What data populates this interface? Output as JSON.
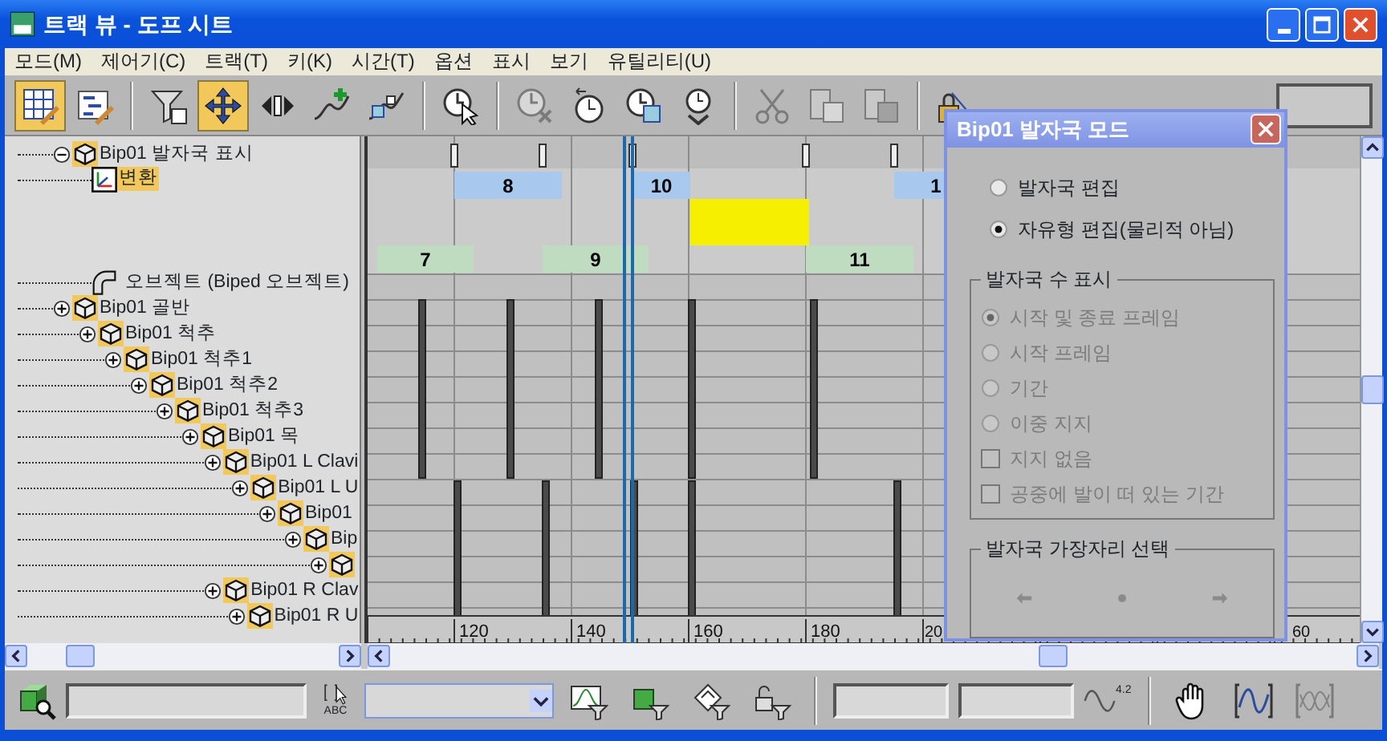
{
  "window": {
    "title": "트랙 뷰 - 도프 시트"
  },
  "menu": [
    "모드(M)",
    "제어기(C)",
    "트랙(T)",
    "키(K)",
    "시간(T)",
    "옵션",
    "표시",
    "보기",
    "유틸리티(U)"
  ],
  "toolbar": [
    {
      "kind": "button",
      "selected": true,
      "disabled": false
    },
    {
      "kind": "button",
      "selected": false,
      "disabled": false
    },
    {
      "kind": "separator"
    },
    {
      "kind": "button",
      "selected": false,
      "disabled": false
    },
    {
      "kind": "button",
      "selected": true,
      "disabled": false
    },
    {
      "kind": "button",
      "selected": false,
      "disabled": false
    },
    {
      "kind": "button",
      "selected": false,
      "disabled": false
    },
    {
      "kind": "button",
      "selected": false,
      "disabled": false
    },
    {
      "kind": "separator"
    },
    {
      "kind": "button",
      "selected": false,
      "disabled": false
    },
    {
      "kind": "separator"
    },
    {
      "kind": "button",
      "selected": false,
      "disabled": true
    },
    {
      "kind": "button",
      "selected": false,
      "disabled": false
    },
    {
      "kind": "button",
      "selected": false,
      "disabled": false
    },
    {
      "kind": "button",
      "selected": false,
      "disabled": false
    },
    {
      "kind": "separator"
    },
    {
      "kind": "button",
      "selected": false,
      "disabled": true
    },
    {
      "kind": "button",
      "selected": false,
      "disabled": true
    },
    {
      "kind": "button",
      "selected": false,
      "disabled": true
    },
    {
      "kind": "separator"
    },
    {
      "kind": "button",
      "selected": false,
      "disabled": false
    }
  ],
  "tree": [
    {
      "kind": "bone",
      "label": "Bip01 발자국 표시",
      "expanded": true,
      "children": [
        {
          "kind": "transform",
          "label": "변환",
          "selected": true
        },
        {
          "kind": "object",
          "label": "오브젝트 (Biped 오브젝트)",
          "selected": false
        }
      ]
    },
    {
      "kind": "bone",
      "label": "Bip01 골반",
      "expanded": false,
      "children": [
        {
          "kind": "bone",
          "label": "Bip01 척추",
          "expanded": false,
          "children": [
            {
              "kind": "bone",
              "label": "Bip01 척추1",
              "expanded": false,
              "children": [
                {
                  "kind": "bone",
                  "label": "Bip01 척추2",
                  "expanded": false,
                  "children": [
                    {
                      "kind": "bone",
                      "label": "Bip01 척추3",
                      "expanded": false,
                      "children": [
                        {
                          "kind": "bone",
                          "label": "Bip01 목",
                          "expanded": false,
                          "children": [
                            {
                              "kind": "bone",
                              "label": "Bip01 L Clavi",
                              "expanded": false,
                              "children": [
                                {
                                  "kind": "bone",
                                  "label": "Bip01 L U",
                                  "expanded": false,
                                  "children": [
                                    {
                                      "kind": "bone",
                                      "label": "Bip01",
                                      "expanded": false,
                                      "children": [
                                        {
                                          "kind": "bone",
                                          "label": "Bip",
                                          "expanded": false,
                                          "children": [
                                            {
                                              "kind": "bone",
                                              "expanded": false
                                            }
                                          ]
                                        }
                                      ]
                                    }
                                  ]
                                }
                              ]
                            },
                            {
                              "kind": "bone",
                              "label": "Bip01 R Clav",
                              "expanded": false,
                              "children": [
                                {
                                  "kind": "bone",
                                  "label": "Bip01 R U",
                                  "expanded": false
                                }
                              ]
                            }
                          ]
                        }
                      ]
                    }
                  ]
                }
              ]
            }
          ]
        }
      ]
    }
  ],
  "footsteps": [
    {
      "kind": "right",
      "label": "8"
    },
    {
      "kind": "right",
      "label": "10"
    },
    {
      "kind": "right",
      "label": "1"
    },
    {
      "kind": "left",
      "label": "7"
    },
    {
      "kind": "left",
      "label": "9"
    },
    {
      "kind": "left",
      "label": "11"
    }
  ],
  "ruler": [
    "120",
    "140",
    "160",
    "180",
    "20",
    "60"
  ],
  "dialog": {
    "title": "Bip01 발자국 모드",
    "modes": [
      {
        "label": "발자국 편집",
        "selected": false
      },
      {
        "label": "자유형 편집(물리적 아님)",
        "selected": true
      }
    ],
    "display_group": {
      "title": "발자국 수 표시",
      "options": [
        {
          "kind": "radio",
          "label": "시작 및 종료 프레임",
          "selected": true,
          "disabled": true
        },
        {
          "kind": "radio",
          "label": "시작 프레임",
          "selected": false,
          "disabled": true
        },
        {
          "kind": "radio",
          "label": "기간",
          "selected": false,
          "disabled": true
        },
        {
          "kind": "radio",
          "label": "이중 지지",
          "selected": false,
          "disabled": true
        },
        {
          "kind": "checkbox",
          "label": "지지 없음",
          "checked": false,
          "disabled": true
        },
        {
          "kind": "checkbox",
          "label": "공중에 발이 떠 있는 기간",
          "checked": false,
          "disabled": true
        }
      ]
    },
    "edge_group": {
      "title": "발자국 가장자리 선택",
      "disabled": true
    }
  },
  "bottom_toolbar": {
    "select_label": "ABC",
    "curve_label": "4.2"
  }
}
